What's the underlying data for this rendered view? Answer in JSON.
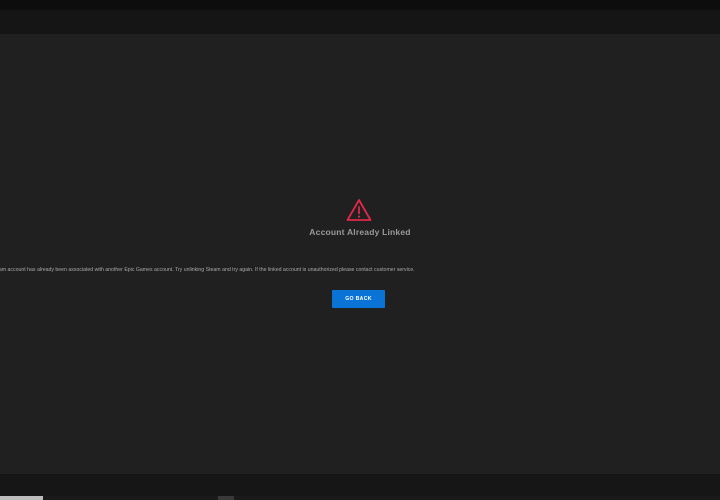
{
  "dialog": {
    "icon": "warning-triangle-icon",
    "title": "Account Already Linked",
    "message": "eam account has already been associated with another Epic Games account. Try unlinking Steam and try again. If the linked account is unauthorized please contact customer service.",
    "button_label": "GO BACK"
  },
  "colors": {
    "background": "#202020",
    "warning": "#e0284a",
    "button": "#0a74d6"
  }
}
